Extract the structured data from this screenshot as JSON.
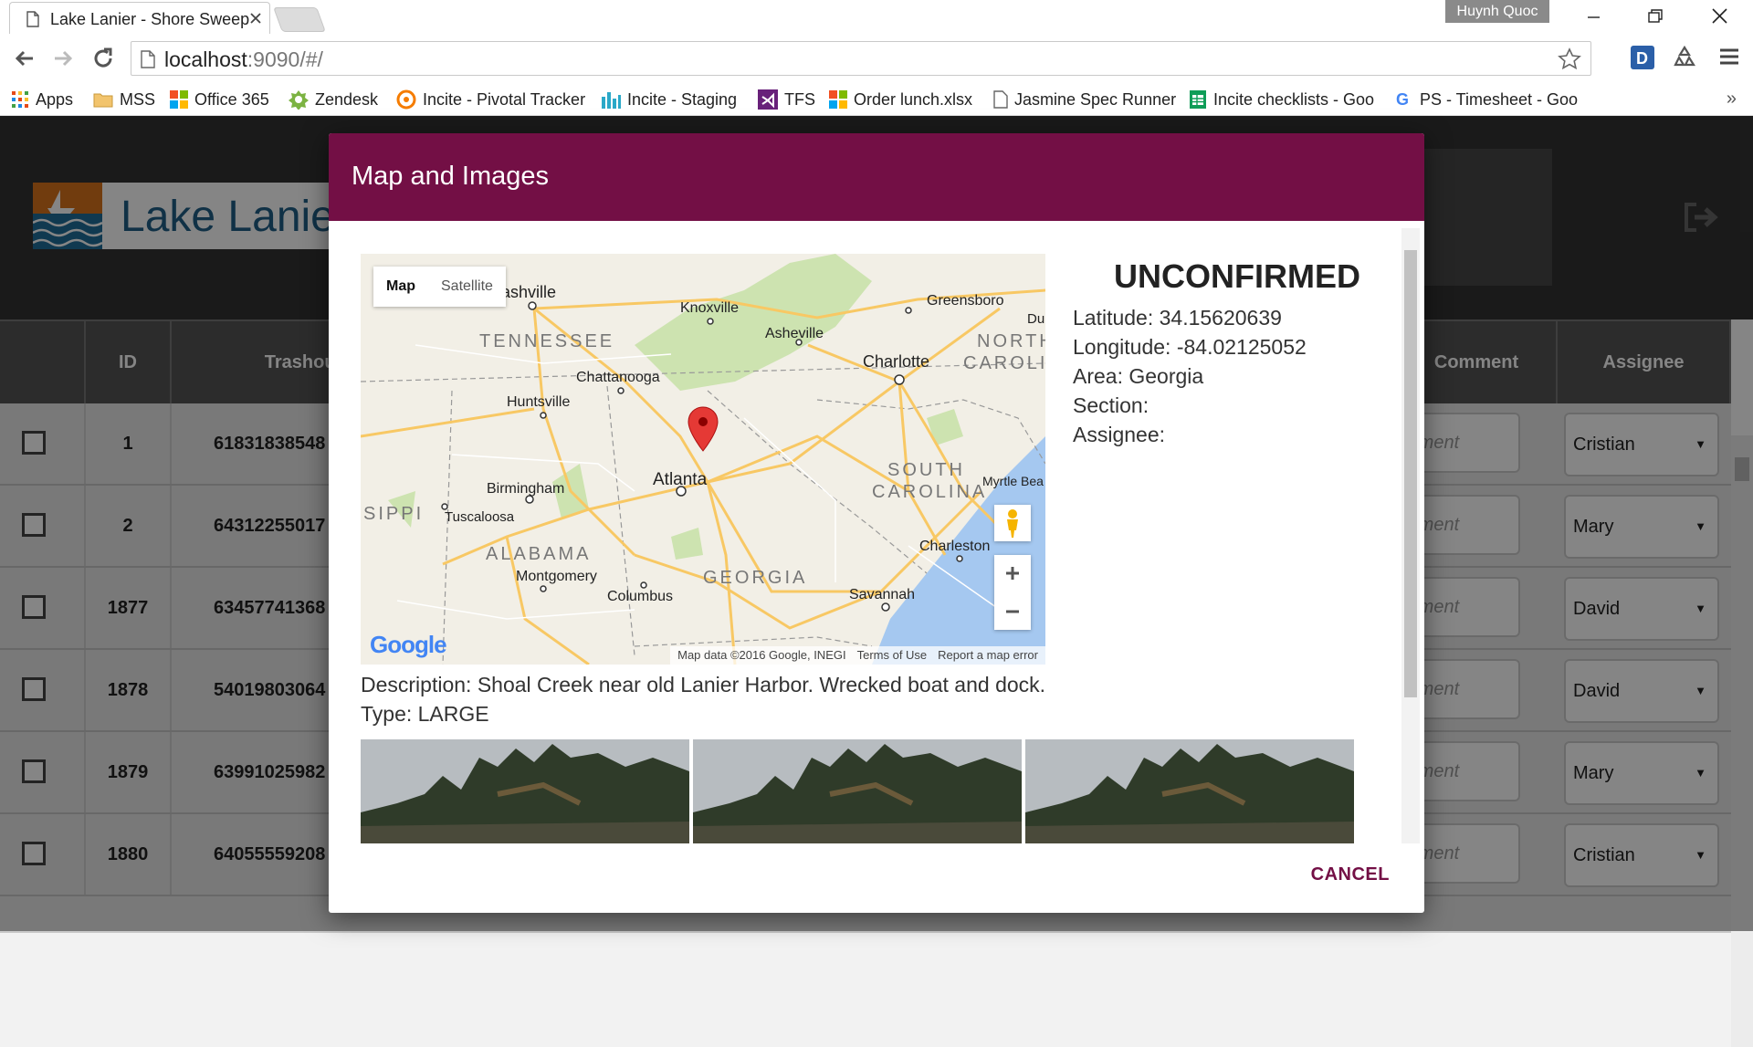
{
  "browser": {
    "tab_title": "Lake Lanier - Shore Sweep",
    "profile_name": "Huynh Quoc",
    "url_host": "localhost",
    "url_rest": ":9090/#/",
    "bookmarks": [
      "Apps",
      "MSS",
      "Office 365",
      "Zendesk",
      "Incite - Pivotal Tracker",
      "Incite - Staging",
      "TFS",
      "Order lunch.xlsx",
      "Jasmine Spec Runner",
      "Incite checklists - Goo",
      "PS - Timesheet - Goo"
    ],
    "more_bookmarks": "»"
  },
  "app": {
    "logo_main": "Lake Lanie",
    "logo_accent": "",
    "columns": [
      "ID",
      "Trashout",
      "Comment",
      "Assignee"
    ],
    "rows": [
      {
        "id": "1",
        "trashout": "61831838548",
        "comment_placeholder": "mment",
        "assignee": "Cristian"
      },
      {
        "id": "2",
        "trashout": "64312255017",
        "comment_placeholder": "mment",
        "assignee": "Mary"
      },
      {
        "id": "1877",
        "trashout": "63457741368",
        "comment_placeholder": "mment",
        "assignee": "David"
      },
      {
        "id": "1878",
        "trashout": "54019803064",
        "comment_placeholder": "mment",
        "assignee": "David"
      },
      {
        "id": "1879",
        "trashout": "63991025982",
        "comment_placeholder": "mment",
        "assignee": "Mary"
      },
      {
        "id": "1880",
        "trashout": "64055559208",
        "comment_placeholder": "mment",
        "assignee": "Cristian"
      }
    ]
  },
  "modal": {
    "title": "Map and Images",
    "status": "UNCONFIRMED",
    "latitude": "Latitude: 34.15620639",
    "longitude": "Longitude: -84.02125052",
    "area": "Area: Georgia",
    "section": "Section:",
    "assignee": "Assignee:",
    "description": "Description: Shoal Creek near old Lanier Harbor. Wrecked boat and dock.",
    "type": "Type: LARGE",
    "cancel_label": "CANCEL",
    "map": {
      "type_map": "Map",
      "type_satellite": "Satellite",
      "attribution": "Map data ©2016 Google, INEGI",
      "terms": "Terms of Use",
      "report": "Report a map error",
      "google": "Google",
      "cities": [
        {
          "name": "Nashville",
          "label": "lashville"
        },
        {
          "name": "Knoxville",
          "label": "Knoxville"
        },
        {
          "name": "Greensboro",
          "label": "Greensboro"
        },
        {
          "name": "Asheville",
          "label": "Asheville"
        },
        {
          "name": "Charlotte",
          "label": "Charlotte"
        },
        {
          "name": "Chattanooga",
          "label": "Chattanooga"
        },
        {
          "name": "Huntsville",
          "label": "Huntsville"
        },
        {
          "name": "Birmingham",
          "label": "Birmingham"
        },
        {
          "name": "Atlanta",
          "label": "Atlanta"
        },
        {
          "name": "Tuscaloosa",
          "label": "Tuscaloosa"
        },
        {
          "name": "Montgomery",
          "label": "Montgomery"
        },
        {
          "name": "Columbus",
          "label": "Columbus"
        },
        {
          "name": "Savannah",
          "label": "Savannah"
        },
        {
          "name": "Charleston",
          "label": "Charleston"
        },
        {
          "name": "Myrtle Beach",
          "label": "Myrtle Bea"
        },
        {
          "name": "Durham",
          "label": "Du"
        }
      ],
      "states": [
        "TENNESSEE",
        "NORTH",
        "CAROLI",
        "SOUTH",
        "CAROLINA",
        "ALABAMA",
        "GEORGIA",
        "SIPPI"
      ]
    }
  },
  "colors": {
    "modal_header": "#730f45",
    "app_header": "#333333",
    "logo_blue": "#1f5f86",
    "logo_orange": "#d9741b"
  }
}
